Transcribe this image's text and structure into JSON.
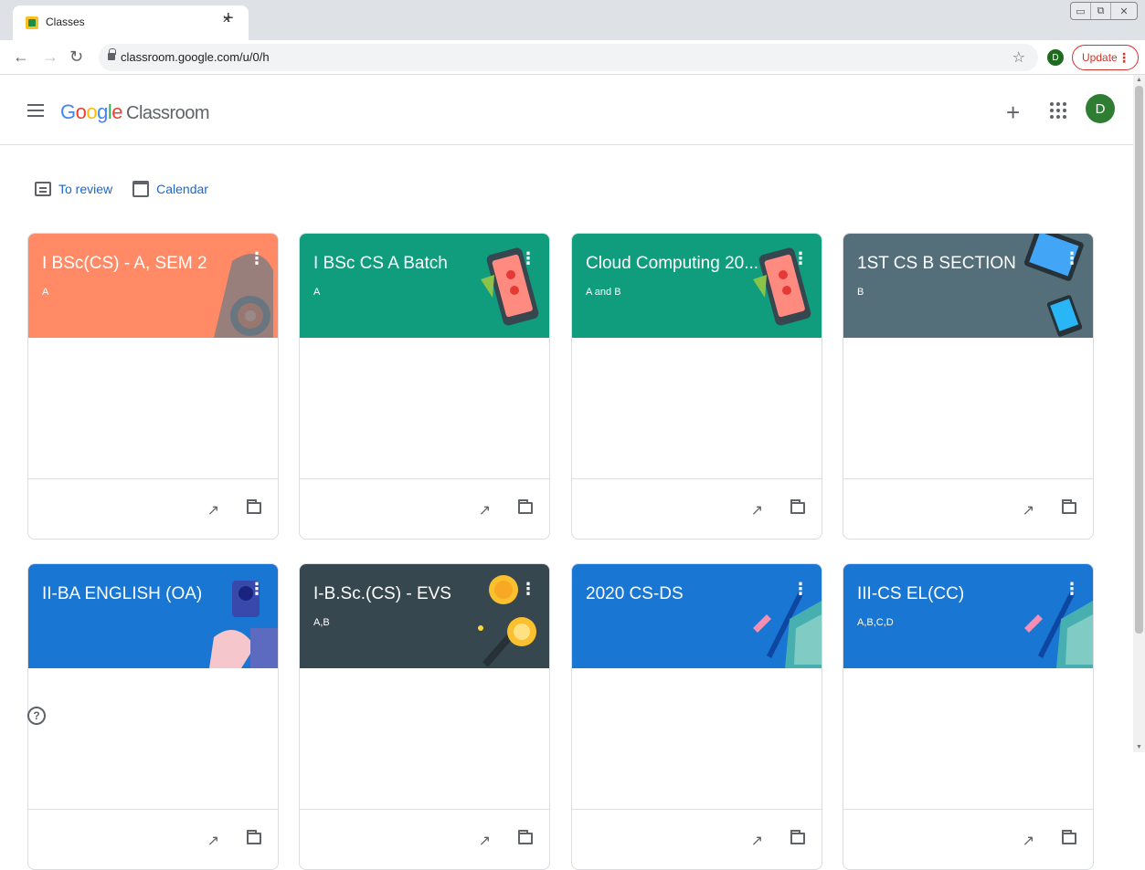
{
  "browser": {
    "tab_title": "Classes",
    "tab_close": "×",
    "new_tab": "+",
    "url": "classroom.google.com/u/0/h",
    "profile_initial": "D",
    "update_label": "Update",
    "window_controls": [
      "▭",
      "⧉",
      "✕"
    ]
  },
  "header": {
    "logo": {
      "g1": "G",
      "o1": "o",
      "o2": "o",
      "g2": "g",
      "l": "l",
      "e": "e"
    },
    "product": "Classroom",
    "create_icon": "+",
    "avatar_initial": "D"
  },
  "quick_links": {
    "to_review": "To review",
    "calendar": "Calendar"
  },
  "classes": [
    {
      "title": "I BSc(CS) - A, SEM 2",
      "section": "A",
      "color": "#ff8a65",
      "theme": "science"
    },
    {
      "title": "I BSc CS A Batch",
      "section": "A",
      "color": "#0f9d7e",
      "theme": "phone"
    },
    {
      "title": "Cloud Computing 20...",
      "section": "A and B",
      "color": "#0f9d7e",
      "theme": "phone"
    },
    {
      "title": "1ST CS B SECTION",
      "section": "B",
      "color": "#546e7a",
      "theme": "tablet"
    },
    {
      "title": "II-BA ENGLISH (OA)",
      "section": "",
      "color": "#1976d2",
      "theme": "camera"
    },
    {
      "title": "I-B.Sc.(CS) - EVS",
      "section": "A,B",
      "color": "#37474f",
      "theme": "coins"
    },
    {
      "title": "2020 CS-DS",
      "section": "",
      "color": "#1976d2",
      "theme": "pencil"
    },
    {
      "title": "III-CS EL(CC)",
      "section": "A,B,C,D",
      "color": "#1976d2",
      "theme": "pencil"
    }
  ],
  "card_actions": {
    "trend_symbol": "↗",
    "menu_symbol": "⋮"
  },
  "help_symbol": "?"
}
